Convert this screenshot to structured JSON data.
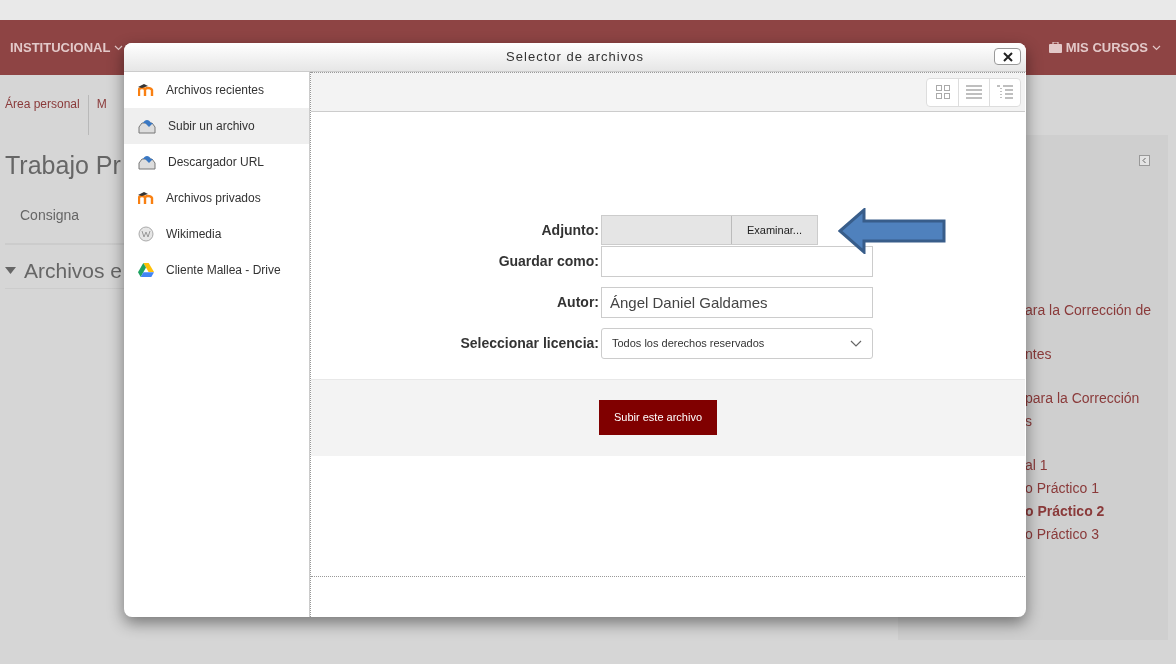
{
  "top_nav": {
    "items": [
      {
        "label": "INSTITUCIONAL"
      },
      {
        "label": "MIS CURSOS"
      }
    ]
  },
  "breadcrumb": [
    "Área personal",
    "M"
  ],
  "page": {
    "title": "Trabajo Pr",
    "tabs": [
      {
        "label": "Consigna"
      }
    ],
    "section": {
      "title": "Archivos e",
      "expanded": true
    }
  },
  "side_block": {
    "groups": [
      {
        "links": [
          {
            "text": "ara la Corrección de",
            "current": false
          }
        ]
      },
      {
        "links": [
          {
            "text": "ntes",
            "current": false
          }
        ]
      },
      {
        "links": [
          {
            "text": "para la Corrección",
            "current": false
          },
          {
            "text": "s",
            "current": false
          }
        ]
      },
      {
        "links": [
          {
            "text": "al 1",
            "current": false
          },
          {
            "text": "o Práctico 1",
            "current": false
          },
          {
            "text": "o Práctico 2",
            "current": true
          },
          {
            "text": "o Práctico 3",
            "current": false
          }
        ]
      }
    ]
  },
  "file_picker": {
    "title": "Selector de archivos",
    "repositories": [
      {
        "label": "Archivos recientes",
        "kind": "moodle",
        "selected": false
      },
      {
        "label": "Subir un archivo",
        "kind": "upload",
        "selected": true
      },
      {
        "label": "Descargador URL",
        "kind": "upload",
        "selected": false
      },
      {
        "label": "Archivos privados",
        "kind": "moodle",
        "selected": false
      },
      {
        "label": "Wikimedia",
        "kind": "wiki",
        "selected": false
      },
      {
        "label": "Cliente Mallea - Drive",
        "kind": "drive",
        "selected": false
      }
    ],
    "view_modes": [
      {
        "kind": "icons"
      },
      {
        "kind": "list"
      },
      {
        "kind": "tree"
      }
    ],
    "form": {
      "fields": [
        {
          "kind": "file",
          "label": "Adjunto:",
          "button": "Examinar..."
        },
        {
          "kind": "text",
          "label": "Guardar como:"
        },
        {
          "kind": "text",
          "label": "Autor:",
          "value": "Ángel Daniel Galdames"
        },
        {
          "kind": "select",
          "label": "Seleccionar licencia:",
          "value": "Todos los derechos reservados"
        }
      ],
      "submit": "Subir este archivo"
    }
  }
}
